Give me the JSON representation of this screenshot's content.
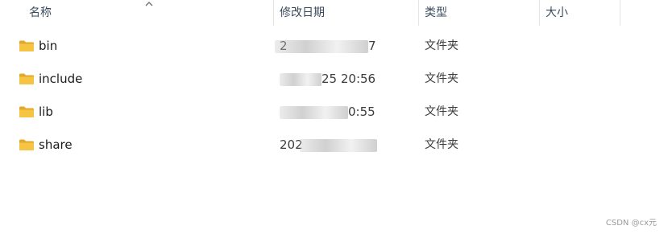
{
  "columns": {
    "name": "名称",
    "modified": "修改日期",
    "type": "类型",
    "size": "大小"
  },
  "rows": [
    {
      "name": "bin",
      "date_visible": "2",
      "date_tail": "7",
      "type": "文件夹"
    },
    {
      "name": "include",
      "date_visible": "",
      "date_tail": "25 20:56",
      "type": "文件夹"
    },
    {
      "name": "lib",
      "date_visible": "",
      "date_tail": "0:55",
      "type": "文件夹"
    },
    {
      "name": "share",
      "date_visible": "202",
      "date_tail": "",
      "type": "文件夹"
    }
  ],
  "watermark": "CSDN @cx元",
  "icons": {
    "folder": "folder-icon",
    "sort": "sort-ascending-icon"
  },
  "colors": {
    "folder": "#f5c443",
    "folder_dark": "#e2a82a",
    "header_text": "#3a4a5c"
  }
}
